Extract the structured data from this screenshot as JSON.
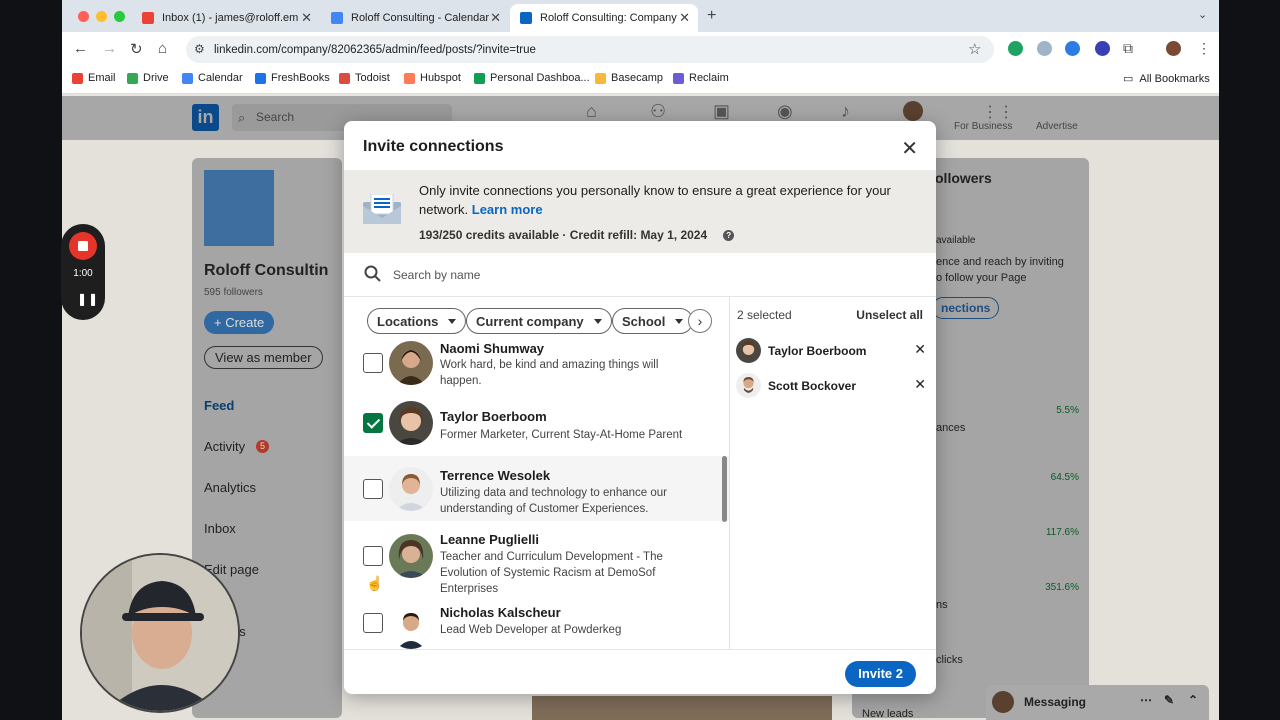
{
  "browser": {
    "tabs": [
      {
        "title": "Inbox (1) - james@roloff.em",
        "color": "#ea4335",
        "active": false
      },
      {
        "title": "Roloff Consulting - Calendar",
        "color": "#4285f4",
        "active": false
      },
      {
        "title": "Roloff Consulting: Company",
        "color": "#0a66c2",
        "active": true
      }
    ],
    "new_tab": "+",
    "url": "linkedin.com/company/82062365/admin/feed/posts/?invite=true",
    "bookmarks": [
      {
        "label": "Email",
        "color": "#ea4335"
      },
      {
        "label": "Drive",
        "color": "#34a853"
      },
      {
        "label": "Calendar",
        "color": "#4285f4"
      },
      {
        "label": "FreshBooks",
        "color": "#1a73e8"
      },
      {
        "label": "Todoist",
        "color": "#db4c3f"
      },
      {
        "label": "Hubspot",
        "color": "#ff7a59"
      },
      {
        "label": "Personal Dashboa...",
        "color": "#0f9d58"
      },
      {
        "label": "Basecamp",
        "color": "#f6b93b"
      },
      {
        "label": "Reclaim",
        "color": "#6b5bd6"
      }
    ],
    "all_bookmarks": "All Bookmarks"
  },
  "linkedin_bg": {
    "search_placeholder": "Search",
    "company_name": "Roloff Consultin",
    "followers": "595 followers",
    "create": "+ Create",
    "view_as_member": "View as member",
    "nav": [
      "Feed",
      "Activity",
      "Analytics",
      "Inbox",
      "Edit page",
      "gs"
    ],
    "activity_badge": "5",
    "for_business": "For Business",
    "advertise": "Advertise",
    "right_title": "ollowers",
    "right_lines": [
      "available",
      "ence and reach by inviting",
      "o follow your Page",
      "nections",
      "ances",
      "ns",
      "clicks",
      "New leads"
    ],
    "right_pcts": [
      "5.5%",
      "64.5%",
      "117.6%",
      "351.6%"
    ],
    "messaging": "Messaging"
  },
  "modal": {
    "title": "Invite connections",
    "banner_text": "Only invite connections you personally know to ensure a great experience for your network.",
    "learn_more": "Learn more",
    "credits": "193/250 credits available · Credit refill: May 1, 2024",
    "search_placeholder": "Search by name",
    "filters": [
      "Locations",
      "Current company",
      "School"
    ],
    "people": [
      {
        "name": "Naomi Shumway",
        "headline": "Work hard, be kind and amazing things will happen.",
        "checked": false
      },
      {
        "name": "Taylor Boerboom",
        "headline": "Former Marketer, Current Stay-At-Home Parent",
        "checked": true
      },
      {
        "name": "Terrence Wesolek",
        "headline": "Utilizing data and technology to enhance our understanding of Customer Experiences.",
        "checked": false
      },
      {
        "name": "Leanne Puglielli",
        "headline": "Teacher and Curriculum Development - The Evolution of Systemic Racism at DemoSof Enterprises",
        "checked": false
      },
      {
        "name": "Nicholas Kalscheur",
        "headline": "Lead Web Developer at Powderkeg",
        "checked": false
      }
    ],
    "selected_count": "2 selected",
    "unselect_all": "Unselect all",
    "selected": [
      {
        "name": "Taylor Boerboom"
      },
      {
        "name": "Scott Bockover"
      }
    ],
    "invite_button": "Invite 2"
  },
  "recorder": {
    "time": "1:00"
  }
}
